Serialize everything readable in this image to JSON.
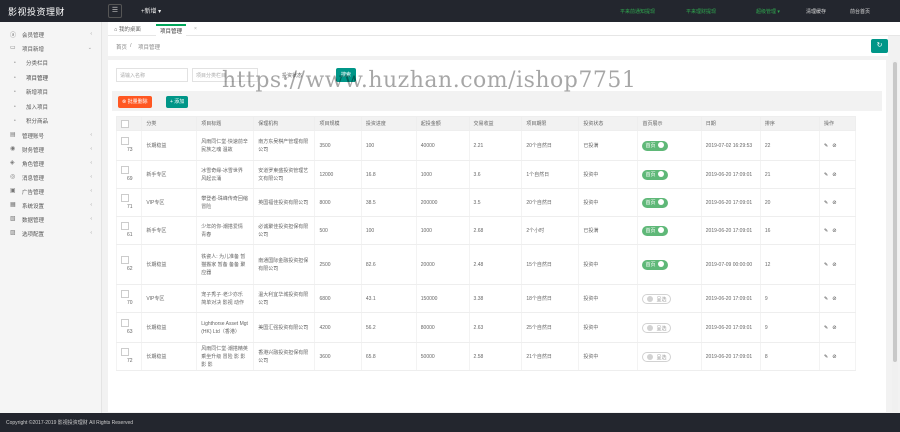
{
  "app": {
    "title": "影视投资理财",
    "add_menu": "+新增 ▾"
  },
  "top_links": [
    {
      "label": "平来前通知提现",
      "color": "#2fa84f"
    },
    {
      "label": "平来理财提现",
      "color": "#2fa84f"
    },
    {
      "label": "超级管理 ▾",
      "color": "#2fa84f"
    },
    {
      "label": "清理缓存",
      "color": "#dddddd"
    },
    {
      "label": "前台首页",
      "color": "#dddddd"
    }
  ],
  "sidebar": [
    {
      "icon": "ⓐ",
      "label": "会员管理",
      "sub": false
    },
    {
      "icon": "▭",
      "label": "项目新增",
      "sub": false,
      "open": true
    },
    {
      "icon": "•",
      "label": "分类栏目",
      "sub": true
    },
    {
      "icon": "•",
      "label": "项目管理",
      "sub": true,
      "active": true
    },
    {
      "icon": "•",
      "label": "新增项目",
      "sub": true
    },
    {
      "icon": "•",
      "label": "加入项目",
      "sub": true
    },
    {
      "icon": "•",
      "label": "积分商品",
      "sub": true
    },
    {
      "icon": "▤",
      "label": "管理账号",
      "sub": false
    },
    {
      "icon": "◉",
      "label": "财务管理",
      "sub": false
    },
    {
      "icon": "◈",
      "label": "角色管理",
      "sub": false
    },
    {
      "icon": "◎",
      "label": "消息管理",
      "sub": false
    },
    {
      "icon": "▣",
      "label": "广告管理",
      "sub": false
    },
    {
      "icon": "▦",
      "label": "系统设置",
      "sub": false
    },
    {
      "icon": "▧",
      "label": "数据管理",
      "sub": false
    },
    {
      "icon": "▨",
      "label": "选项配置",
      "sub": false
    }
  ],
  "tabs": {
    "home": "我的桌面",
    "current": "项目管理",
    "close": "×"
  },
  "breadcrumb": {
    "home": "首页",
    "sep": "/",
    "current": "项目管理"
  },
  "filters": {
    "name_placeholder": "请输入名称",
    "category_label": "项目分类栏目",
    "category_value": "",
    "status_label": "投资状态",
    "search": "搜索"
  },
  "toolbar": {
    "batch_delete": "⊗ 批量删除",
    "add": "+ 添加"
  },
  "table": {
    "headers": [
      "",
      "分类",
      "项目标题",
      "保理机构",
      "项目规模",
      "投资进度",
      "起投金额",
      "交易收益",
      "项目期限",
      "投资状态",
      "首页展示",
      "日期",
      "排序",
      "操作"
    ],
    "rows": [
      {
        "id": "73",
        "cat": "长期稳益",
        "title": "风雨同仁堂·快速前辛 民族之魂 温故",
        "org": "南方东吴棋产管理有限公司",
        "scale": "3500",
        "progress": "100",
        "min": "40000",
        "yield": "2.21",
        "term": "20个自然日",
        "status": "已投满",
        "show": "首页",
        "show_on": true,
        "date": "2019-07-02 16:29:53",
        "sort": "22"
      },
      {
        "id": "69",
        "cat": "新手专区",
        "title": "冰雪奇缘-冰雪世界 风起云涌",
        "org": "安道罗柬盛投资管理艺文有限公司",
        "scale": "12000",
        "progress": "16.8",
        "min": "1000",
        "yield": "3.6",
        "term": "1个自然日",
        "status": "投资中",
        "show": "首页",
        "show_on": true,
        "date": "2019-06-20 17:09:01",
        "sort": "21"
      },
      {
        "id": "71",
        "cat": "VIP专区",
        "title": "攀登者-珠峰传奇回缩 冒险",
        "org": "英国福佳投资有限公司",
        "scale": "8000",
        "progress": "38.5",
        "min": "200000",
        "yield": "3.5",
        "term": "20个自然日",
        "status": "投资中",
        "show": "首页",
        "show_on": true,
        "date": "2019-06-20 17:09:01",
        "sort": "20"
      },
      {
        "id": "61",
        "cat": "新手专区",
        "title": "少年的你-潮搭爱情 青春",
        "org": "必诚聚佳投资担保有限公司",
        "scale": "500",
        "progress": "100",
        "min": "1000",
        "yield": "2.68",
        "term": "2个小时",
        "status": "已投满",
        "show": "首页",
        "show_on": true,
        "date": "2019-06-20 17:09:01",
        "sort": "16"
      },
      {
        "id": "62",
        "cat": "长期稳益",
        "title": "铁瓷人: 为儿准备 暂猫搬家 暂备 备备 聚 应器",
        "org": "南通国际金融投资担保有限公司",
        "scale": "2500",
        "progress": "82.6",
        "min": "20000",
        "yield": "2.48",
        "term": "15个自然日",
        "status": "投资中",
        "show": "首页",
        "show_on": true,
        "date": "2019-07-09 00:00:00",
        "sort": "12"
      },
      {
        "id": "70",
        "cat": "VIP专区",
        "title": "宠子秀子·老少亦乐 简单对决 影视 动作",
        "org": "温大利宜华城投资有限公司",
        "scale": "6800",
        "progress": "43.1",
        "min": "150000",
        "yield": "3.38",
        "term": "18个自然日",
        "status": "投资中",
        "show": "呈选",
        "show_on": false,
        "date": "2019-06-20 17:09:01",
        "sort": "9"
      },
      {
        "id": "63",
        "cat": "长期稳益",
        "title": "Lighthorse Asset Mgt (HK) Ltd（香港）",
        "org": "美国汇强投资有限公司",
        "scale": "4200",
        "progress": "56.2",
        "min": "80000",
        "yield": "2.63",
        "term": "25个自然日",
        "status": "投资中",
        "show": "呈选",
        "show_on": false,
        "date": "2019-06-20 17:09:01",
        "sort": "9"
      },
      {
        "id": "72",
        "cat": "长期稳益",
        "title": "风雨同仁堂·潮搭精英 乘坐升级 冒险 影 影 影 影",
        "org": "香港兴融投资担保有限公司",
        "scale": "3600",
        "progress": "65.8",
        "min": "50000",
        "yield": "2.58",
        "term": "21个自然日",
        "status": "投资中",
        "show": "呈选",
        "show_on": false,
        "date": "2019-06-20 17:09:01",
        "sort": "8"
      }
    ],
    "op_edit": "✎",
    "op_delete": "⊘"
  },
  "watermark": "https://www.huzhan.com/ishop7751",
  "footer": "Copyright ©2017-2019 影视投资理财 All Rights Reserved"
}
